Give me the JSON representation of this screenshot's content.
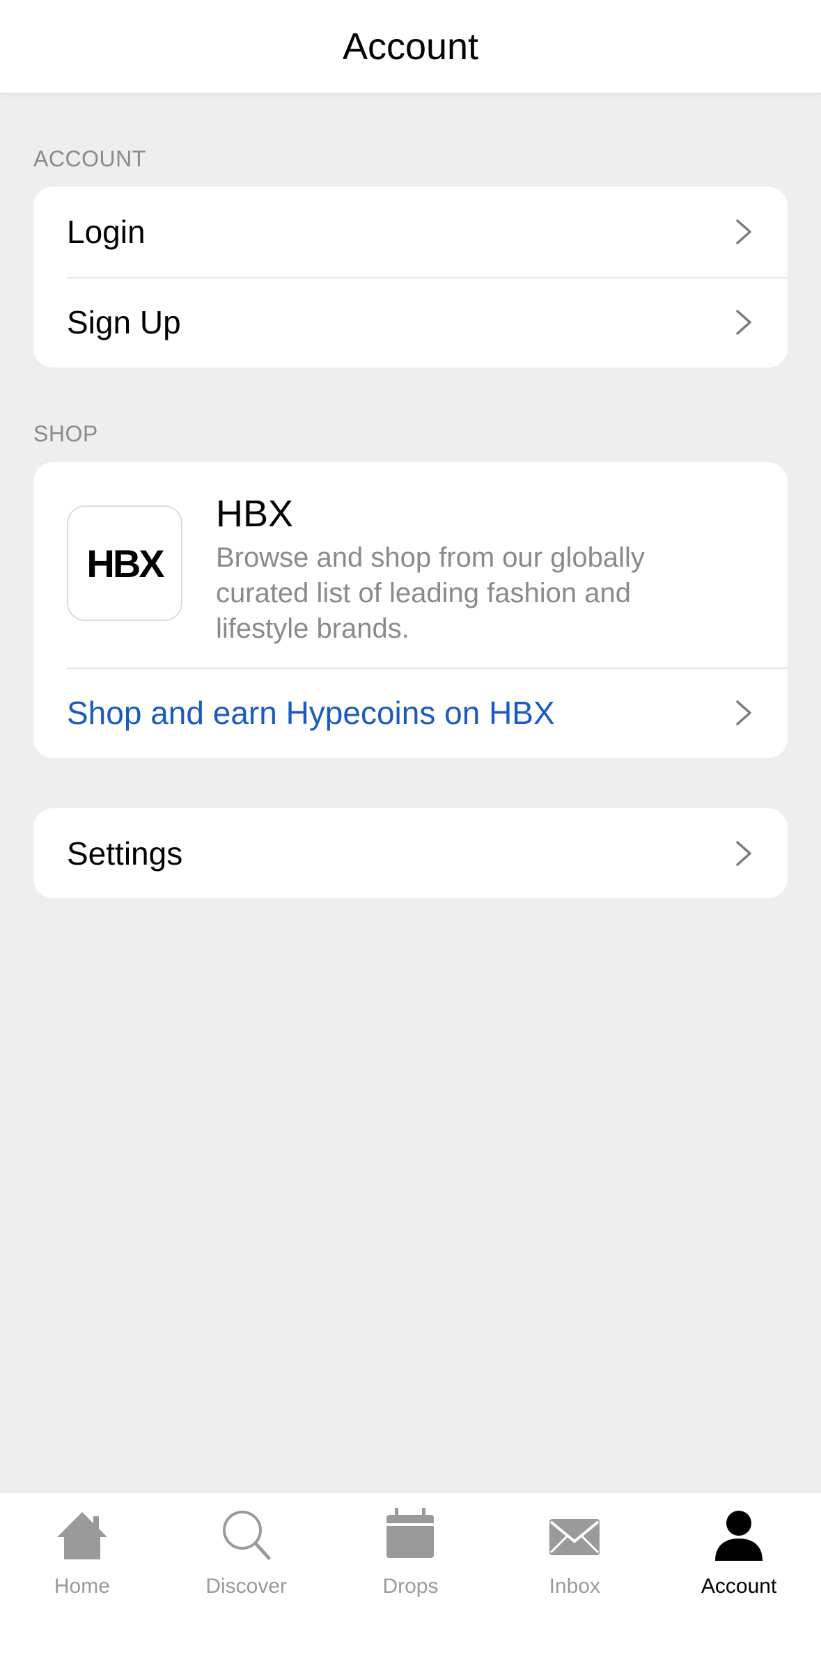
{
  "header": {
    "title": "Account"
  },
  "account_section": {
    "label": "ACCOUNT",
    "items": [
      {
        "label": "Login"
      },
      {
        "label": "Sign Up"
      }
    ]
  },
  "shop_section": {
    "label": "SHOP",
    "hbx": {
      "logo_text": "HBX",
      "title": "HBX",
      "description": "Browse and shop from our globally curated list of leading fashion and lifestyle brands.",
      "link_label": "Shop and earn Hypecoins on HBX",
      "link_color": "#1a5bbf"
    }
  },
  "settings": {
    "label": "Settings"
  },
  "tabbar": {
    "active": "Account",
    "tabs": [
      {
        "label": "Home",
        "icon": "home-icon"
      },
      {
        "label": "Discover",
        "icon": "search-icon"
      },
      {
        "label": "Drops",
        "icon": "calendar-icon"
      },
      {
        "label": "Inbox",
        "icon": "mail-icon"
      },
      {
        "label": "Account",
        "icon": "person-icon"
      }
    ]
  }
}
